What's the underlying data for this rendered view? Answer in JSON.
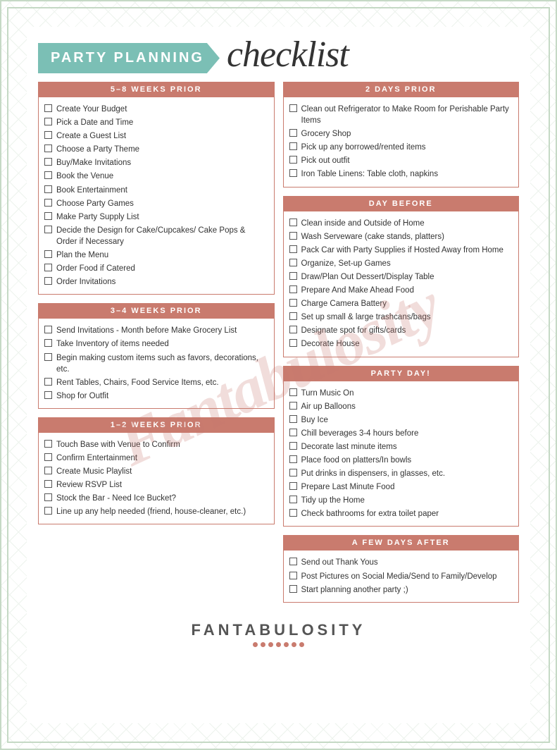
{
  "page": {
    "title": "PARTY PLANNING checklist",
    "banner_text": "PARTY PLANNING",
    "script_text": "checklist",
    "footer_brand": "FANTABULOSITY",
    "watermark": "Fantabulosity"
  },
  "sections": {
    "weeks_5_8": {
      "header": "5–8 WEEKS PRIOR",
      "items": [
        "Create Your Budget",
        "Pick a Date and Time",
        "Create a Guest List",
        "Choose a Party Theme",
        "Buy/Make Invitations",
        "Book the Venue",
        "Book Entertainment",
        "Choose Party Games",
        "Make Party Supply List",
        "Decide the Design for Cake/Cupcakes/ Cake Pops & Order if Necessary",
        "Plan the Menu",
        "Order Food if Catered",
        "Order Invitations"
      ]
    },
    "weeks_3_4": {
      "header": "3–4 WEEKS PRIOR",
      "items": [
        "Send Invitations - Month before Make Grocery List",
        "Take Inventory of items needed",
        "Begin making custom items such as favors, decorations, etc.",
        "Rent Tables, Chairs, Food Service Items, etc.",
        "Shop for Outfit"
      ]
    },
    "weeks_1_2": {
      "header": "1–2 WEEKS PRIOR",
      "items": [
        "Touch Base with Venue to Confirm",
        "Confirm Entertainment",
        "Create Music Playlist",
        "Review RSVP List",
        "Stock the Bar - Need Ice Bucket?",
        "Line up any help needed (friend, house-cleaner, etc.)"
      ]
    },
    "days_2": {
      "header": "2 DAYS PRIOR",
      "items": [
        "Clean out Refrigerator to Make Room for Perishable Party Items",
        "Grocery Shop",
        "Pick up any borrowed/rented items",
        "Pick out outfit",
        "Iron Table Linens: Table cloth, napkins"
      ]
    },
    "day_before": {
      "header": "DAY BEFORE",
      "items": [
        "Clean inside and Outside of Home",
        "Wash Serveware (cake stands, platters)",
        "Pack Car with Party Supplies if Hosted Away from Home",
        "Organize, Set-up Games",
        "Draw/Plan Out Dessert/Display Table",
        "Prepare And Make Ahead Food",
        "Charge Camera Battery",
        "Set up small & large trashcans/bags",
        "Designate spot for gifts/cards",
        "Decorate House"
      ]
    },
    "party_day": {
      "header": "PARTY DAY!",
      "items": [
        "Turn Music On",
        "Air up Balloons",
        "Buy Ice",
        "Chill beverages 3-4 hours before",
        "Decorate last minute items",
        "Place food on platters/In bowls",
        "Put drinks in dispensers, in glasses, etc.",
        "Prepare Last Minute Food",
        "Tidy up the Home",
        "Check bathrooms for extra toilet paper"
      ]
    },
    "days_after": {
      "header": "A FEW DAYS AFTER",
      "items": [
        "Send out Thank Yous",
        "Post Pictures on Social Media/Send to Family/Develop",
        "Start planning another party ;)"
      ]
    }
  }
}
